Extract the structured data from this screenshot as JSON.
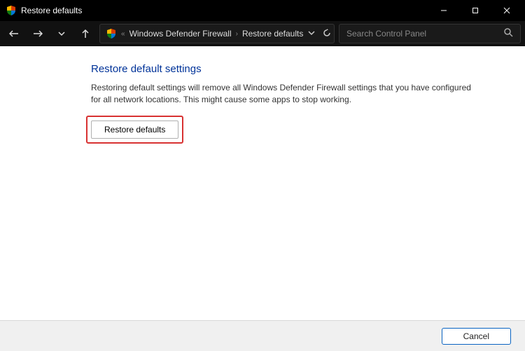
{
  "window": {
    "title": "Restore defaults"
  },
  "breadcrumb": {
    "root_sep": "«",
    "parent": "Windows Defender Firewall",
    "sep": "›",
    "current": "Restore defaults"
  },
  "search": {
    "placeholder": "Search Control Panel"
  },
  "page": {
    "heading": "Restore default settings",
    "description": "Restoring default settings will remove all Windows Defender Firewall settings that you have configured for all network locations. This might cause some apps to stop working.",
    "restore_button": "Restore defaults"
  },
  "footer": {
    "cancel": "Cancel"
  }
}
